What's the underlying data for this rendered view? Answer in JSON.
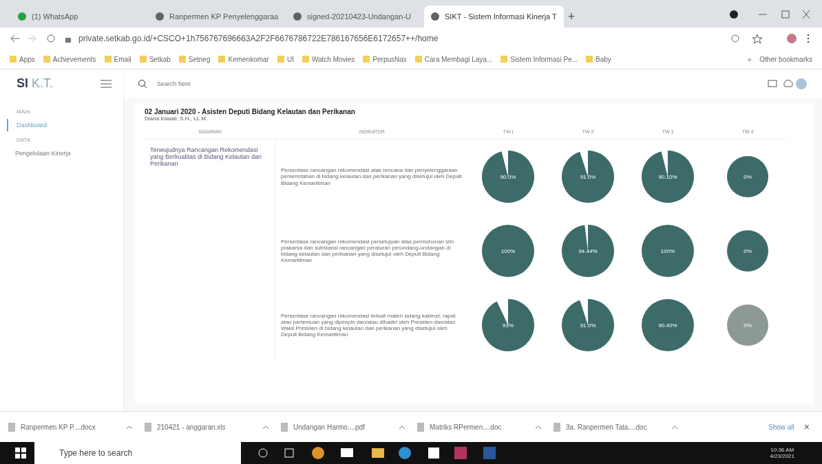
{
  "browser": {
    "tabs": [
      {
        "label": "(1) WhatsApp",
        "selected": false,
        "color": "#25a244"
      },
      {
        "label": "Ranpermen KP Penyelenggaraa",
        "selected": false,
        "color": "#5f6368"
      },
      {
        "label": "signed-20210423-Undangan-U",
        "selected": false,
        "color": "#5f6368"
      },
      {
        "label": "SIKT - Sistem Informasi Kinerja T",
        "selected": true,
        "color": "#5f6368"
      }
    ],
    "new_tab": "+",
    "url": "private.setkab.go.id/+CSCO+1h756767696663A2F2F6676786722E786167656E6172657++/home",
    "bookmarks": [
      "Apps",
      "Achievements",
      "Email",
      "Setkab",
      "Setneg",
      "Kemenkomar",
      "UI",
      "Watch Movies",
      "PerpusNas",
      "Cara Membagi Laya...",
      "Sistem Informasi Pe...",
      "Baby"
    ],
    "more": "»",
    "other": "Other bookmarks"
  },
  "app": {
    "logo_bold": "SI",
    "logo_rest": "K.T.",
    "search_placeholder": "Search here"
  },
  "sidebar": {
    "sections": [
      {
        "heading": "MAIN",
        "items": [
          {
            "label": "Dashboard",
            "selected": true
          }
        ]
      },
      {
        "heading": "DATA",
        "items": [
          {
            "label": "Pengelolaan Kinerja",
            "selected": false
          }
        ]
      }
    ]
  },
  "report": {
    "title": "02 Januari 2020 - Asisten Deputi Bidang Kelautan dan Perikanan",
    "subtitle": "Diana Irawati, S.H., LL.M.",
    "columns": [
      "SASARAN",
      "INDIKATOR",
      "TW I",
      "TW 2",
      "TW 3",
      "TW 4"
    ],
    "sasaran": "Terwujudnya Rancangan Rekomendasi yang Berkualitas di Bidang Kelautan dan Perikanan",
    "rows": [
      {
        "indikator": "Persentase rancangan rekomendasi atas rencana dan penyelenggaraan pemerintahan di bidang kelautan dan perikanan yang disetujui oleh Deputi Bidang Kemaritiman",
        "values": [
          {
            "label": "90.0%",
            "level": 0.96,
            "color": "#3d6b6a"
          },
          {
            "label": "91.0%",
            "level": 0.95,
            "color": "#3d6b6a"
          },
          {
            "label": "90.10%",
            "level": 0.96,
            "color": "#3d6b6a"
          },
          {
            "label": "0%",
            "color": "#3d6b6a"
          }
        ]
      },
      {
        "indikator": "Persentase rancangan rekomendasi persetujuan atas permohonan izin prakarsa dan substansi rancangan peraturan perundang-undangan di bidang kelautan dan perikanan yang disetujui oleh Deputi Bidang Kemaritiman",
        "values": [
          {
            "label": "100%",
            "level": 1,
            "color": "#3d6b6a"
          },
          {
            "label": "94.44%",
            "level": 0.98,
            "color": "#3d6b6a"
          },
          {
            "label": "100%",
            "level": 1,
            "color": "#3d6b6a"
          },
          {
            "label": "0%",
            "color": "#3d6b6a"
          }
        ]
      },
      {
        "indikator": "Persentase rancangan rekomendasi terkait materi sidang kabinet, rapat atau pertemuan yang dipimpin dan/atau dihadiri oleh Presiden dan/atau Wakil Presiden di bidang kelautan dan perikanan yang disetujui oleh Deputi Bidang Kemaritiman",
        "values": [
          {
            "label": "93%",
            "level": 0.93,
            "color": "#3d6b6a"
          },
          {
            "label": "91.0%",
            "level": 0.95,
            "color": "#3d6b6a"
          },
          {
            "label": "90.40%",
            "level": 1,
            "color": "#3d6b6a"
          },
          {
            "label": "0%",
            "color": "#8d9a94"
          }
        ]
      }
    ]
  },
  "downloads": {
    "files": [
      "Ranpermen KP P....docx",
      "210421 - anggaran.xls",
      "Undangan Harmo....pdf",
      "Matriks RPermen....doc",
      "3a. Ranpermen Tata....doc"
    ],
    "show_all": "Show all",
    "close": "×"
  },
  "taskbar": {
    "search_placeholder": "Type here to search",
    "time": "10:36 AM",
    "date": "4/23/2021"
  }
}
